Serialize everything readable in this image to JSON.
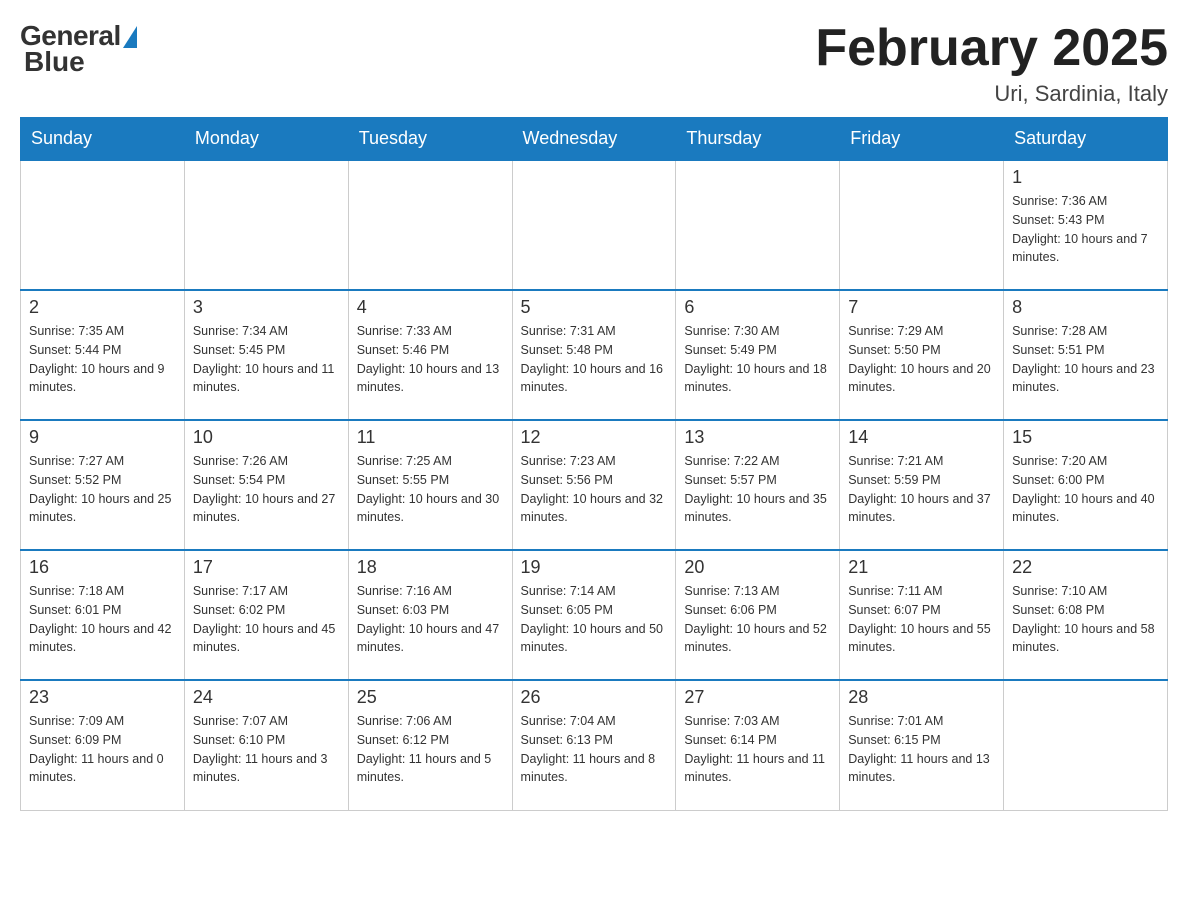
{
  "logo": {
    "general": "General",
    "blue": "Blue"
  },
  "title": "February 2025",
  "location": "Uri, Sardinia, Italy",
  "days_of_week": [
    "Sunday",
    "Monday",
    "Tuesday",
    "Wednesday",
    "Thursday",
    "Friday",
    "Saturday"
  ],
  "weeks": [
    [
      {
        "day": "",
        "info": "",
        "empty": true
      },
      {
        "day": "",
        "info": "",
        "empty": true
      },
      {
        "day": "",
        "info": "",
        "empty": true
      },
      {
        "day": "",
        "info": "",
        "empty": true
      },
      {
        "day": "",
        "info": "",
        "empty": true
      },
      {
        "day": "",
        "info": "",
        "empty": true
      },
      {
        "day": "1",
        "info": "Sunrise: 7:36 AM\nSunset: 5:43 PM\nDaylight: 10 hours and 7 minutes.",
        "empty": false
      }
    ],
    [
      {
        "day": "2",
        "info": "Sunrise: 7:35 AM\nSunset: 5:44 PM\nDaylight: 10 hours and 9 minutes.",
        "empty": false
      },
      {
        "day": "3",
        "info": "Sunrise: 7:34 AM\nSunset: 5:45 PM\nDaylight: 10 hours and 11 minutes.",
        "empty": false
      },
      {
        "day": "4",
        "info": "Sunrise: 7:33 AM\nSunset: 5:46 PM\nDaylight: 10 hours and 13 minutes.",
        "empty": false
      },
      {
        "day": "5",
        "info": "Sunrise: 7:31 AM\nSunset: 5:48 PM\nDaylight: 10 hours and 16 minutes.",
        "empty": false
      },
      {
        "day": "6",
        "info": "Sunrise: 7:30 AM\nSunset: 5:49 PM\nDaylight: 10 hours and 18 minutes.",
        "empty": false
      },
      {
        "day": "7",
        "info": "Sunrise: 7:29 AM\nSunset: 5:50 PM\nDaylight: 10 hours and 20 minutes.",
        "empty": false
      },
      {
        "day": "8",
        "info": "Sunrise: 7:28 AM\nSunset: 5:51 PM\nDaylight: 10 hours and 23 minutes.",
        "empty": false
      }
    ],
    [
      {
        "day": "9",
        "info": "Sunrise: 7:27 AM\nSunset: 5:52 PM\nDaylight: 10 hours and 25 minutes.",
        "empty": false
      },
      {
        "day": "10",
        "info": "Sunrise: 7:26 AM\nSunset: 5:54 PM\nDaylight: 10 hours and 27 minutes.",
        "empty": false
      },
      {
        "day": "11",
        "info": "Sunrise: 7:25 AM\nSunset: 5:55 PM\nDaylight: 10 hours and 30 minutes.",
        "empty": false
      },
      {
        "day": "12",
        "info": "Sunrise: 7:23 AM\nSunset: 5:56 PM\nDaylight: 10 hours and 32 minutes.",
        "empty": false
      },
      {
        "day": "13",
        "info": "Sunrise: 7:22 AM\nSunset: 5:57 PM\nDaylight: 10 hours and 35 minutes.",
        "empty": false
      },
      {
        "day": "14",
        "info": "Sunrise: 7:21 AM\nSunset: 5:59 PM\nDaylight: 10 hours and 37 minutes.",
        "empty": false
      },
      {
        "day": "15",
        "info": "Sunrise: 7:20 AM\nSunset: 6:00 PM\nDaylight: 10 hours and 40 minutes.",
        "empty": false
      }
    ],
    [
      {
        "day": "16",
        "info": "Sunrise: 7:18 AM\nSunset: 6:01 PM\nDaylight: 10 hours and 42 minutes.",
        "empty": false
      },
      {
        "day": "17",
        "info": "Sunrise: 7:17 AM\nSunset: 6:02 PM\nDaylight: 10 hours and 45 minutes.",
        "empty": false
      },
      {
        "day": "18",
        "info": "Sunrise: 7:16 AM\nSunset: 6:03 PM\nDaylight: 10 hours and 47 minutes.",
        "empty": false
      },
      {
        "day": "19",
        "info": "Sunrise: 7:14 AM\nSunset: 6:05 PM\nDaylight: 10 hours and 50 minutes.",
        "empty": false
      },
      {
        "day": "20",
        "info": "Sunrise: 7:13 AM\nSunset: 6:06 PM\nDaylight: 10 hours and 52 minutes.",
        "empty": false
      },
      {
        "day": "21",
        "info": "Sunrise: 7:11 AM\nSunset: 6:07 PM\nDaylight: 10 hours and 55 minutes.",
        "empty": false
      },
      {
        "day": "22",
        "info": "Sunrise: 7:10 AM\nSunset: 6:08 PM\nDaylight: 10 hours and 58 minutes.",
        "empty": false
      }
    ],
    [
      {
        "day": "23",
        "info": "Sunrise: 7:09 AM\nSunset: 6:09 PM\nDaylight: 11 hours and 0 minutes.",
        "empty": false
      },
      {
        "day": "24",
        "info": "Sunrise: 7:07 AM\nSunset: 6:10 PM\nDaylight: 11 hours and 3 minutes.",
        "empty": false
      },
      {
        "day": "25",
        "info": "Sunrise: 7:06 AM\nSunset: 6:12 PM\nDaylight: 11 hours and 5 minutes.",
        "empty": false
      },
      {
        "day": "26",
        "info": "Sunrise: 7:04 AM\nSunset: 6:13 PM\nDaylight: 11 hours and 8 minutes.",
        "empty": false
      },
      {
        "day": "27",
        "info": "Sunrise: 7:03 AM\nSunset: 6:14 PM\nDaylight: 11 hours and 11 minutes.",
        "empty": false
      },
      {
        "day": "28",
        "info": "Sunrise: 7:01 AM\nSunset: 6:15 PM\nDaylight: 11 hours and 13 minutes.",
        "empty": false
      },
      {
        "day": "",
        "info": "",
        "empty": true
      }
    ]
  ]
}
